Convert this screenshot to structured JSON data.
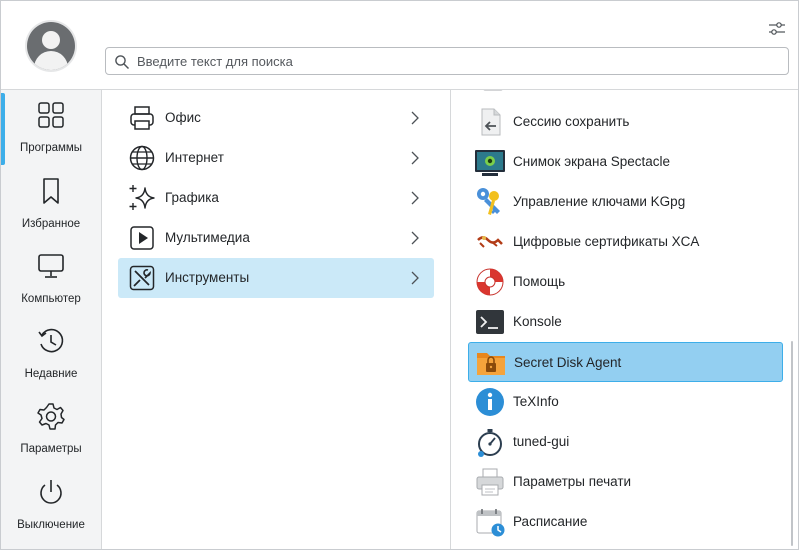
{
  "search": {
    "placeholder": "Введите текст для поиска",
    "value": ""
  },
  "nav": {
    "items": [
      {
        "label": "Программы",
        "icon": "grid-icon",
        "active": true
      },
      {
        "label": "Избранное",
        "icon": "bookmark-icon",
        "active": false
      },
      {
        "label": "Компьютер",
        "icon": "monitor-icon",
        "active": false
      },
      {
        "label": "Недавние",
        "icon": "history-icon",
        "active": false
      },
      {
        "label": "Параметры",
        "icon": "gear-icon",
        "active": false
      },
      {
        "label": "Выключение",
        "icon": "power-icon",
        "active": false
      }
    ]
  },
  "categories": {
    "items": [
      {
        "label": "Офис",
        "icon": "printer-icon"
      },
      {
        "label": "Интернет",
        "icon": "globe-icon"
      },
      {
        "label": "Графика",
        "icon": "sparkle-icon"
      },
      {
        "label": "Мультимедиа",
        "icon": "play-icon"
      },
      {
        "label": "Инструменты",
        "icon": "tools-icon",
        "selected": true
      }
    ]
  },
  "apps": {
    "items": [
      {
        "label": "Сессию сохранить",
        "icon": "session-save-icon"
      },
      {
        "label": "Снимок экрана Spectacle",
        "icon": "spectacle-icon"
      },
      {
        "label": "Управление ключами KGpg",
        "icon": "keys-icon"
      },
      {
        "label": "Цифровые сертификаты XCA",
        "icon": "certificate-icon"
      },
      {
        "label": "Помощь",
        "icon": "lifebuoy-icon"
      },
      {
        "label": "Konsole",
        "icon": "terminal-icon"
      },
      {
        "label": "Secret Disk Agent",
        "icon": "secret-disk-icon",
        "selected": true
      },
      {
        "label": "TeXInfo",
        "icon": "info-icon"
      },
      {
        "label": "tuned-gui",
        "icon": "stopwatch-icon"
      },
      {
        "label": "Параметры печати",
        "icon": "print-settings-icon"
      },
      {
        "label": "Расписание",
        "icon": "calendar-icon"
      }
    ]
  },
  "colors": {
    "accent": "#3daee9",
    "selection": "#93cff1",
    "category_selection": "#cbe9f8"
  }
}
